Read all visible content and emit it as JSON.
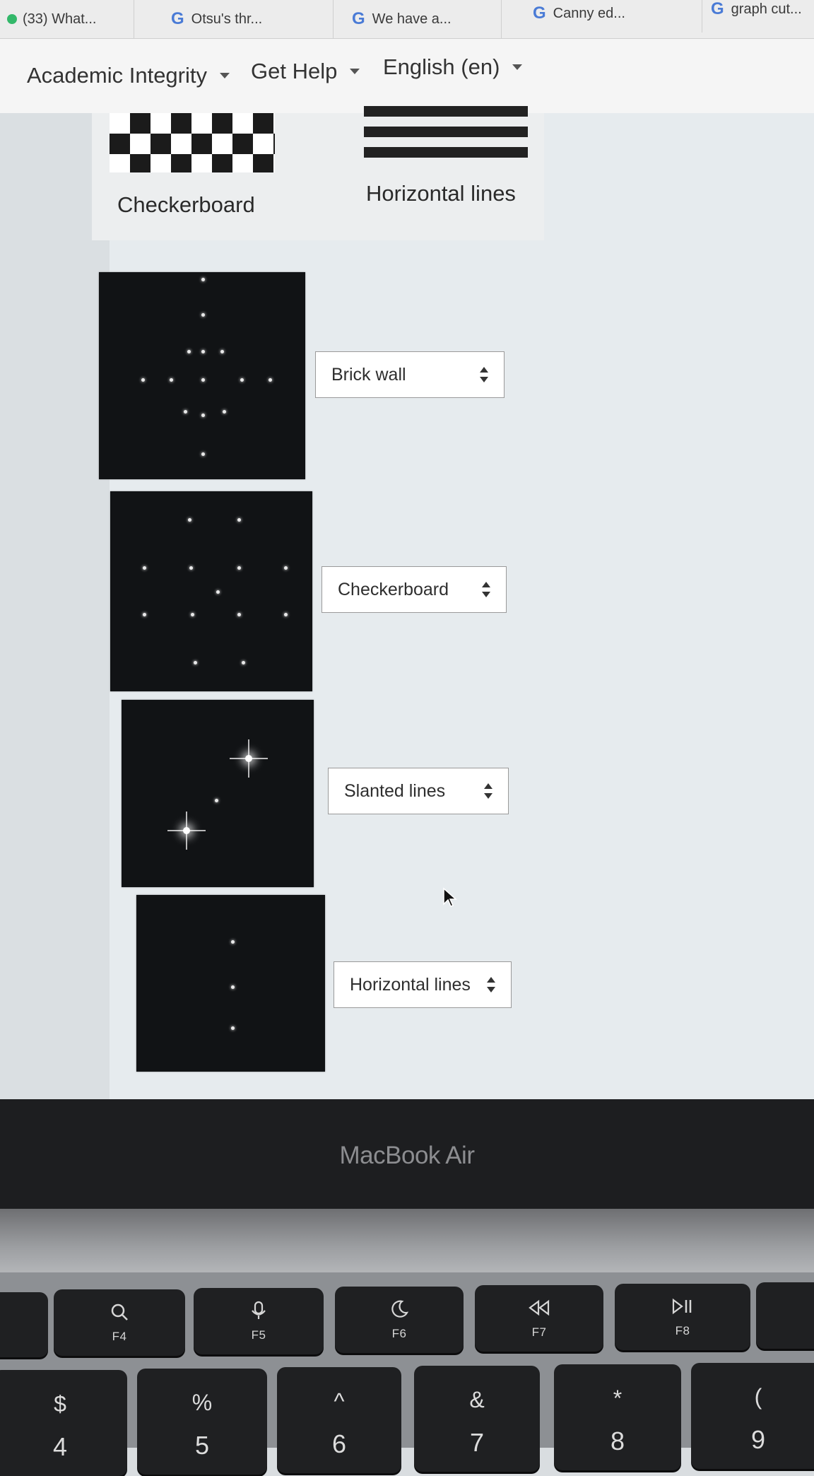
{
  "bookmarks": [
    {
      "label": "(33) What..."
    },
    {
      "label": "Otsu's thr..."
    },
    {
      "label": "We have a..."
    },
    {
      "label": "Canny ed..."
    },
    {
      "label": "graph cut..."
    }
  ],
  "bookmark_icon_letter": "G",
  "nav": {
    "academic_integrity": "Academic Integrity",
    "get_help": "Get Help",
    "language": "English (en)"
  },
  "legend": {
    "checkerboard": "Checkerboard",
    "horizontal_lines": "Horizontal lines"
  },
  "matches": [
    {
      "image_icon": "fft-spectrum-image",
      "selected": "Brick wall"
    },
    {
      "image_icon": "fft-spectrum-image",
      "selected": "Checkerboard"
    },
    {
      "image_icon": "fft-spectrum-image",
      "selected": "Slanted lines"
    },
    {
      "image_icon": "fft-spectrum-image",
      "selected": "Horizontal lines"
    }
  ],
  "laptop": {
    "bezel_label": "MacBook Air"
  },
  "keyboard": {
    "function_keys": [
      {
        "icon": "search-icon",
        "label": "F4"
      },
      {
        "icon": "microphone-icon",
        "label": "F5"
      },
      {
        "icon": "moon-icon",
        "label": "F6"
      },
      {
        "icon": "rewind-icon",
        "label": "F7"
      },
      {
        "icon": "play-pause-icon",
        "label": "F8"
      }
    ],
    "number_keys": [
      {
        "top": "$",
        "bottom": "4"
      },
      {
        "top": "%",
        "bottom": "5"
      },
      {
        "top": "^",
        "bottom": "6"
      },
      {
        "top": "&",
        "bottom": "7"
      },
      {
        "top": "*",
        "bottom": "8"
      },
      {
        "top": "(",
        "bottom": "9"
      }
    ]
  },
  "colors": {
    "spectrum_background": "#111315",
    "page_background": "#e6ebee",
    "bezel": "#1d1e20"
  }
}
